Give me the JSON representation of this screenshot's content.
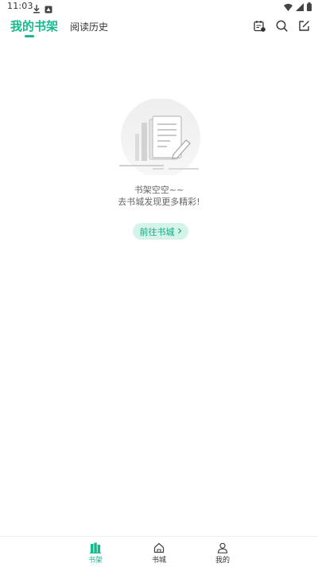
{
  "status_bar": {
    "time": "11:03",
    "icons": [
      "download-icon",
      "notification-icon",
      "wifi-icon",
      "signal-icon",
      "battery-icon"
    ]
  },
  "header": {
    "active_tab": "我的书架",
    "history_tab": "阅读历史",
    "icons": [
      "calendar-checkin-icon",
      "search-icon",
      "edit-icon"
    ],
    "accent_color": "#18b98f"
  },
  "empty_state": {
    "line1": "书架空空~~",
    "line2": "去书城发现更多精彩!",
    "button_label": "前往书城"
  },
  "bottom_nav": {
    "items": [
      {
        "label": "书架",
        "icon": "bookshelf-icon",
        "active": true
      },
      {
        "label": "书城",
        "icon": "home-icon",
        "active": false
      },
      {
        "label": "我的",
        "icon": "profile-icon",
        "active": false
      }
    ]
  }
}
